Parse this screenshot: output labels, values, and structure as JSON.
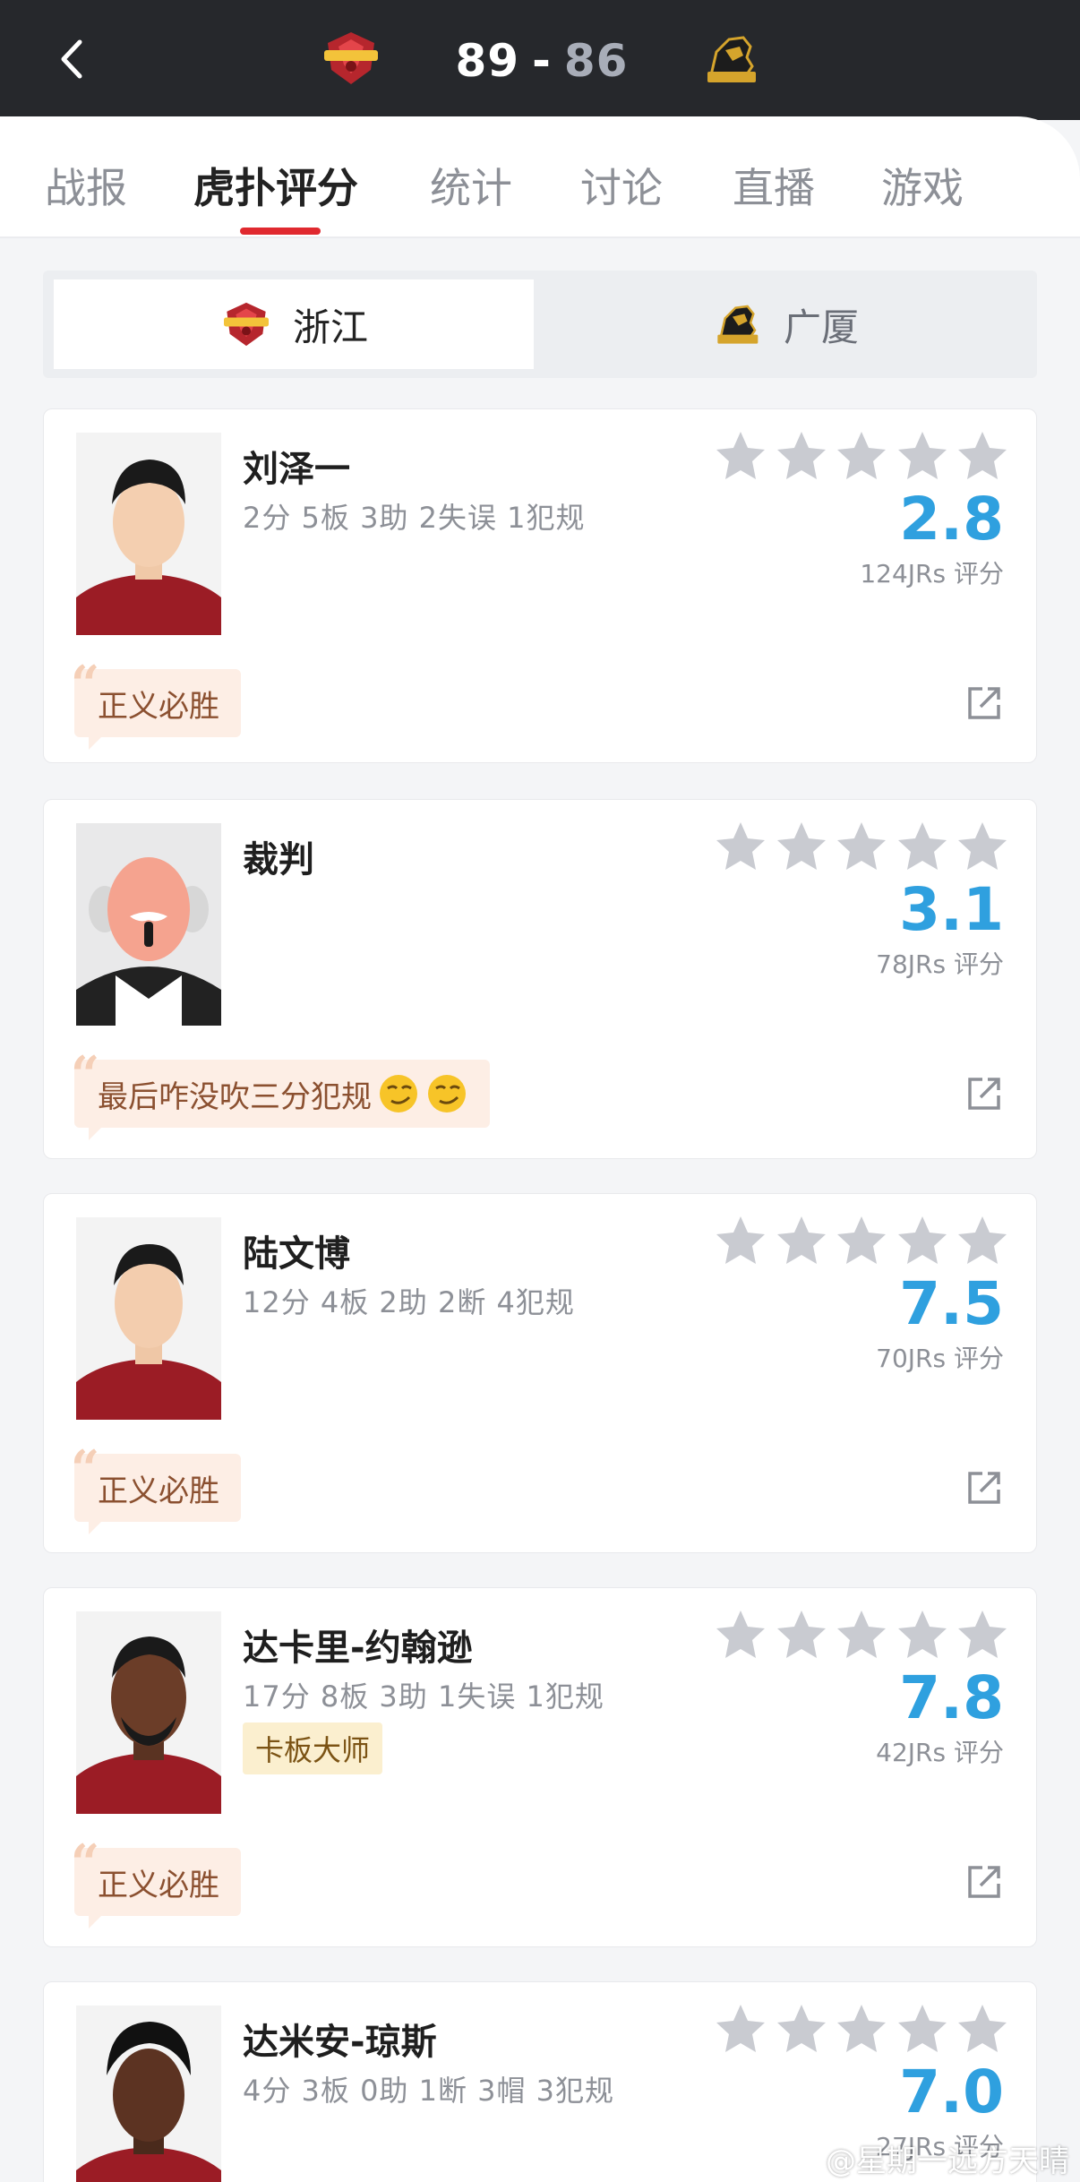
{
  "header": {
    "score_home": "89",
    "score_separator": "-",
    "score_away": "86"
  },
  "tabs": [
    {
      "label": "战报",
      "active": false
    },
    {
      "label": "虎扑评分",
      "active": true
    },
    {
      "label": "统计",
      "active": false
    },
    {
      "label": "讨论",
      "active": false
    },
    {
      "label": "直播",
      "active": false
    },
    {
      "label": "游戏",
      "active": false
    }
  ],
  "team_toggle": {
    "home": "浙江",
    "away": "广厦"
  },
  "cards": [
    {
      "name": "刘泽一",
      "stats": "2分 5板 3助 2失误 1犯规",
      "rating": "2.8",
      "count": "124JRs 评分",
      "comment": "正义必胜"
    },
    {
      "name": "裁判",
      "stats": "",
      "rating": "3.1",
      "count": "78JRs 评分",
      "comment": "最后咋没吹三分犯规"
    },
    {
      "name": "陆文博",
      "stats": "12分 4板 2助 2断 4犯规",
      "rating": "7.5",
      "count": "70JRs 评分",
      "comment": "正义必胜"
    },
    {
      "name": "达卡里-约翰逊",
      "stats": "17分 8板 3助 1失误 1犯规",
      "badge": "卡板大师",
      "rating": "7.8",
      "count": "42JRs 评分",
      "comment": "正义必胜"
    },
    {
      "name": "达米安-琼斯",
      "stats": "4分 3板 0助 1断 3帽 3犯规",
      "rating": "7.0",
      "count": "27JRs 评分"
    }
  ],
  "watermark": "@星期一远方天晴",
  "colors": {
    "accent_red": "#e0292f",
    "rating_blue": "#2fa0df",
    "header_bg": "#26282c"
  }
}
